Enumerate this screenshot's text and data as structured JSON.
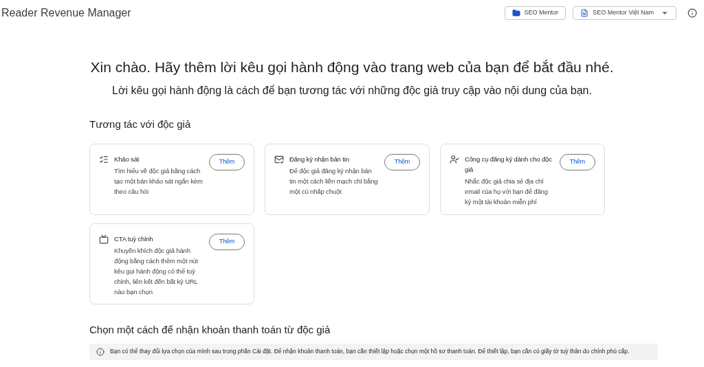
{
  "app_title": "Reader Revenue Manager",
  "header_buttons": [
    {
      "kind": "folder",
      "label": "SEO Mentor",
      "dropdown": false
    },
    {
      "kind": "doc",
      "label": "SEO Mentor Việt Nam",
      "dropdown": true
    }
  ],
  "headline": "Xin chào. Hãy thêm lời kêu gọi hành động vào trang web của bạn để bắt đầu nhé.",
  "subheadline": "Lời kêu gọi hành động là cách để bạn tương tác với những độc giả truy cập vào nội dung của bạn.",
  "engage_section": {
    "heading": "Tương tác với độc giả",
    "cards": [
      {
        "kind": "survey",
        "title": "Khảo sát",
        "description": "Tìm hiểu về độc giả bằng cách tạo một bản khảo sát ngắn kèm theo câu hỏi",
        "button": "Thêm"
      },
      {
        "kind": "newsletter",
        "title": "Đăng ký nhận bản tin",
        "description": "Để độc giả đăng ký nhận bản tin một cách liền mạch chỉ bằng một cú nhấp chuột",
        "button": "Thêm"
      },
      {
        "kind": "signup",
        "title": "Công cụ đăng ký dành cho độc giả",
        "description": "Nhắc độc giả chia sẻ địa chỉ email của họ với bạn để đăng ký một tài khoản miễn phí",
        "button": "Thêm"
      },
      {
        "kind": "custom",
        "title": "CTA tuỳ chỉnh",
        "description": "Khuyến khích độc giả hành động bằng cách thêm một nút kêu gọi hành động có thể tuỳ chỉnh, liên kết đến bất kỳ URL nào bạn chọn",
        "button": "Thêm"
      }
    ]
  },
  "payment_section": {
    "heading": "Chọn một cách để nhận khoản thanh toán từ độc giả",
    "info": "Bạn có thể thay đổi lựa chọn của mình sau trong phần Cài đặt. Để nhận khoản thanh toán, bạn cần thiết lập hoặc chọn một hồ sơ thanh toán. Để thiết lập, bạn cần có giấy tờ tuỳ thân do chính phủ cấp."
  }
}
